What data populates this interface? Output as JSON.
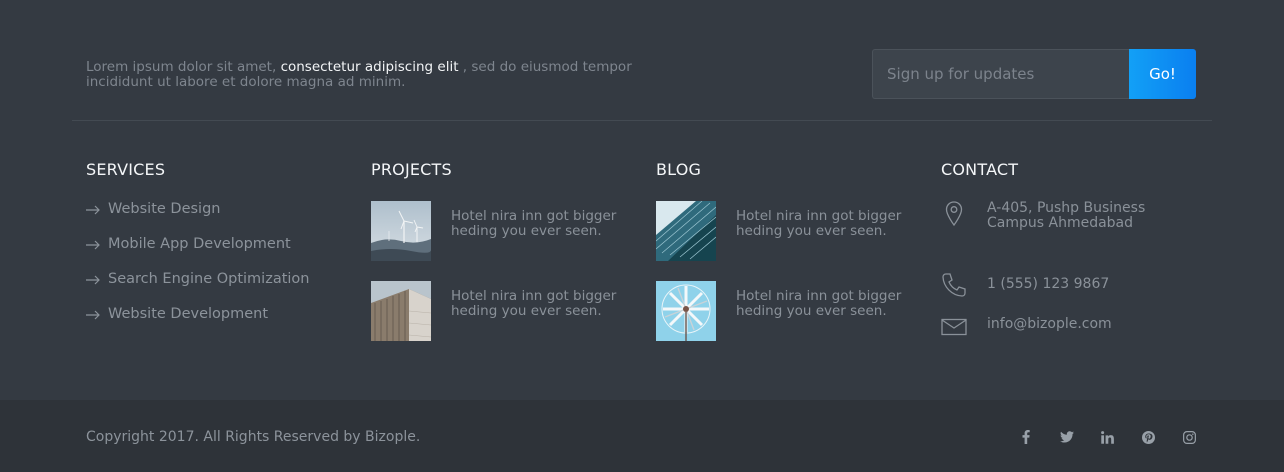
{
  "intro": {
    "before": "Lorem ipsum dolor sit amet, ",
    "highlight": "consectetur adipiscing elit",
    "after": " , sed do eiusmod tempor incididunt ut labore et dolore magna ad minim."
  },
  "signup": {
    "placeholder": "Sign up for updates",
    "button_label": "Go!"
  },
  "services": {
    "title": "SERVICES",
    "items": [
      {
        "label": "Website Design"
      },
      {
        "label": "Mobile App Development"
      },
      {
        "label": "Search Engine Optimization"
      },
      {
        "label": "Website Development"
      }
    ]
  },
  "projects": {
    "title": "PROJECTS",
    "posts": [
      {
        "title": "Hotel nira inn got bigger heding you ever seen.",
        "image": "wind-turbines-photo"
      },
      {
        "title": "Hotel nira inn got bigger heding you ever seen.",
        "image": "wooden-building-photo"
      }
    ]
  },
  "blog": {
    "title": "BLOG",
    "posts": [
      {
        "title": "Hotel nira inn got bigger heding you ever seen.",
        "image": "skyscraper-photo"
      },
      {
        "title": "Hotel nira inn got bigger heding you ever seen.",
        "image": "windmill-photo"
      }
    ]
  },
  "contact": {
    "title": "CONTACT",
    "address": "A-405, Pushp Business Campus Ahmedabad",
    "phone": "1 (555) 123 9867",
    "email": "info@bizople.com",
    "icons": [
      "location-pin-icon",
      "phone-icon",
      "mail-icon"
    ]
  },
  "footer": {
    "copyright": "Copyright 2017. All Rights Reserved by Bizople.",
    "social": [
      "facebook-icon",
      "twitter-icon",
      "linkedin-icon",
      "pinterest-icon",
      "instagram-icon"
    ]
  },
  "colors": {
    "background": "#343a42",
    "bottom_bar": "#2e3339",
    "accent": "#0a7ff0",
    "heading": "#f4f6f8",
    "muted_text": "#8a9199"
  }
}
